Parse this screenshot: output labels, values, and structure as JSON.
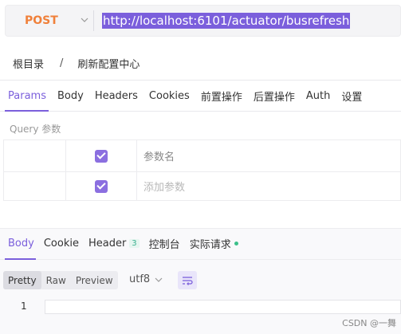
{
  "request": {
    "method": "POST",
    "url": "http://localhost:6101/actuator/busrefresh"
  },
  "breadcrumb": {
    "root": "根目录",
    "separator": "/",
    "current": "刷新配置中心"
  },
  "tabs": [
    "Params",
    "Body",
    "Headers",
    "Cookies",
    "前置操作",
    "后置操作",
    "Auth",
    "设置"
  ],
  "params": {
    "section_label": "Query 参数",
    "rows": [
      {
        "checked": true,
        "name_placeholder": "参数名"
      },
      {
        "checked": true,
        "name_placeholder": "添加参数"
      }
    ]
  },
  "response": {
    "tabs": {
      "body": "Body",
      "cookie": "Cookie",
      "header": "Header",
      "header_count": "3",
      "console": "控制台",
      "actual_request": "实际请求"
    },
    "formats": [
      "Pretty",
      "Raw",
      "Preview"
    ],
    "encoding": "utf8",
    "line_number": "1"
  },
  "watermark": "CSDN @一舞",
  "colors": {
    "accent": "#7b5fdc",
    "method": "#f0803a",
    "status_dot": "#3cc08a"
  },
  "icons": {
    "method_dropdown": "chevron-down-icon",
    "encoding_dropdown": "chevron-down-icon",
    "wrap": "wrap-lines-icon",
    "checkbox": "check-icon"
  }
}
